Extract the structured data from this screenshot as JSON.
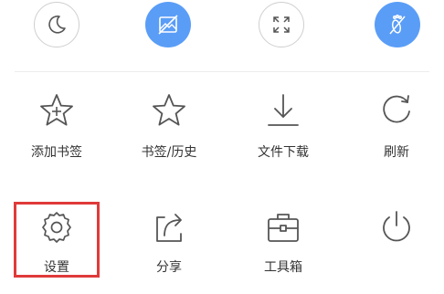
{
  "toggles": [
    {
      "icon": "moon-icon",
      "style": "outline"
    },
    {
      "icon": "no-image-icon",
      "style": "filled"
    },
    {
      "icon": "fullscreen-icon",
      "style": "outline"
    },
    {
      "icon": "footprint-icon",
      "style": "filled"
    }
  ],
  "menu": {
    "row1": [
      {
        "label": "添加书签",
        "icon": "star-plus-icon"
      },
      {
        "label": "书签/历史",
        "icon": "star-icon"
      },
      {
        "label": "文件下载",
        "icon": "download-icon"
      },
      {
        "label": "刷新",
        "icon": "refresh-icon"
      }
    ],
    "row2": [
      {
        "label": "设置",
        "icon": "gear-icon",
        "highlighted": true
      },
      {
        "label": "分享",
        "icon": "share-icon"
      },
      {
        "label": "工具箱",
        "icon": "toolbox-icon"
      },
      {
        "label": "",
        "icon": "power-icon"
      }
    ]
  },
  "colors": {
    "accent": "#5a9df7",
    "highlight": "#e03a3a",
    "icon_stroke": "#555555",
    "label": "#333333"
  }
}
